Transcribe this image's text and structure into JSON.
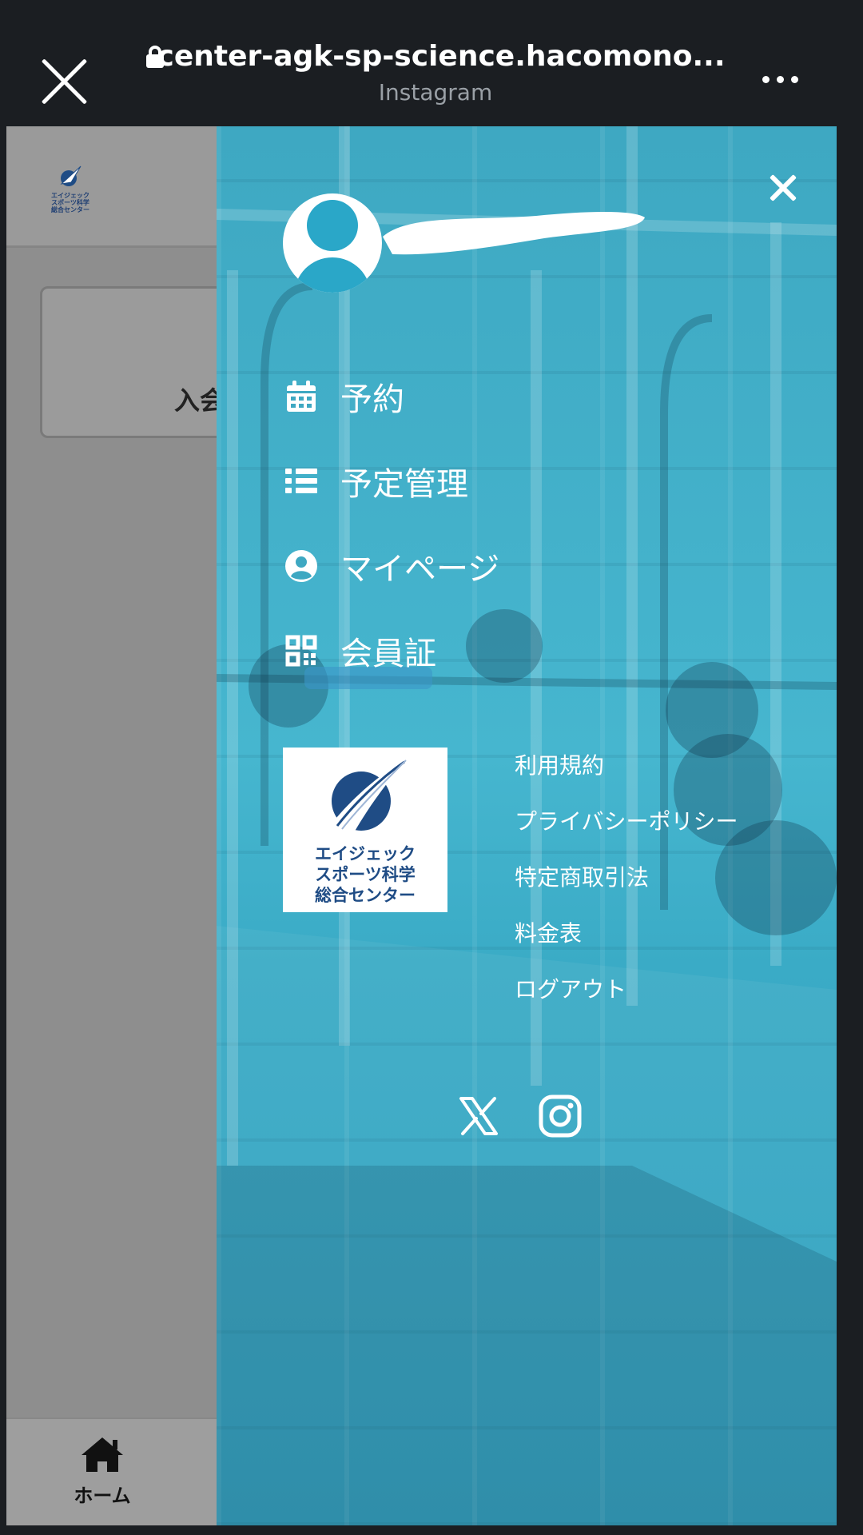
{
  "browser": {
    "url": "center-agk-sp-science.hacomono...",
    "source": "Instagram"
  },
  "page": {
    "card_text": "入会",
    "bottom_nav": {
      "home_label": "ホーム"
    },
    "logo_text": [
      "エイジェック",
      "スポーツ科学",
      "総合センター"
    ]
  },
  "drawer": {
    "menu": [
      {
        "label": "予約",
        "icon": "calendar-icon"
      },
      {
        "label": "予定管理",
        "icon": "list-icon"
      },
      {
        "label": "マイページ",
        "icon": "user-circle-icon"
      },
      {
        "label": "会員証",
        "icon": "qr-code-icon"
      }
    ],
    "logo_text": [
      "エイジェック",
      "スポーツ科学",
      "総合センター"
    ],
    "links": [
      "利用規約",
      "プライバシーポリシー",
      "特定商取引法",
      "料金表",
      "ログアウト"
    ],
    "social": [
      "x-icon",
      "instagram-icon"
    ]
  },
  "colors": {
    "drawer_bg": "#3ea8c2",
    "topbar_bg": "#1b1e22",
    "brand_blue": "#1f4c85"
  }
}
